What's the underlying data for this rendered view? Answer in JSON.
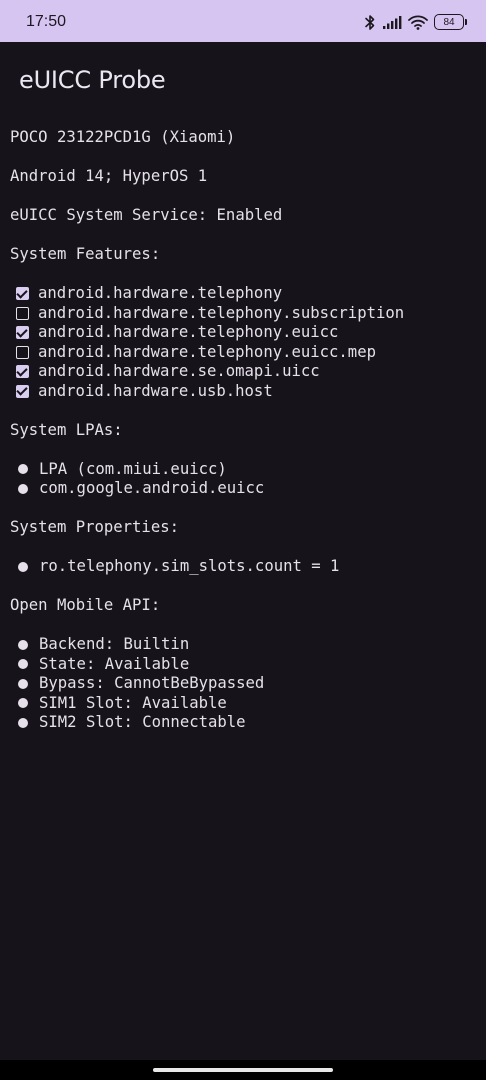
{
  "status_bar": {
    "time": "17:50",
    "battery_level": "84",
    "icons": [
      "bluetooth-icon",
      "signal-icon",
      "wifi-icon",
      "battery-icon"
    ]
  },
  "app": {
    "title": "eUICC Probe"
  },
  "device": {
    "model": "POCO 23122PCD1G (Xiaomi)",
    "os": "Android 14; HyperOS 1",
    "euicc_service": "eUICC System Service: Enabled"
  },
  "system_features": {
    "heading": "System Features:",
    "items": [
      {
        "label": "android.hardware.telephony",
        "checked": true
      },
      {
        "label": "android.hardware.telephony.subscription",
        "checked": false
      },
      {
        "label": "android.hardware.telephony.euicc",
        "checked": true
      },
      {
        "label": "android.hardware.telephony.euicc.mep",
        "checked": false
      },
      {
        "label": "android.hardware.se.omapi.uicc",
        "checked": true
      },
      {
        "label": "android.hardware.usb.host",
        "checked": true
      }
    ]
  },
  "system_lpas": {
    "heading": "System LPAs:",
    "items": [
      "LPA (com.miui.euicc)",
      "com.google.android.euicc"
    ]
  },
  "system_properties": {
    "heading": "System Properties:",
    "items": [
      "ro.telephony.sim_slots.count = 1"
    ]
  },
  "open_mobile_api": {
    "heading": "Open Mobile API:",
    "items": [
      "Backend: Builtin",
      "State: Available",
      "Bypass: CannotBeBypassed",
      "SIM1 Slot: Available",
      "SIM2 Slot: Connectable"
    ]
  },
  "colors": {
    "status_bar_bg": "#d7c5f1",
    "background": "#16141a",
    "text": "#e6e0ea",
    "checkbox_fill": "#d9cdf0"
  }
}
